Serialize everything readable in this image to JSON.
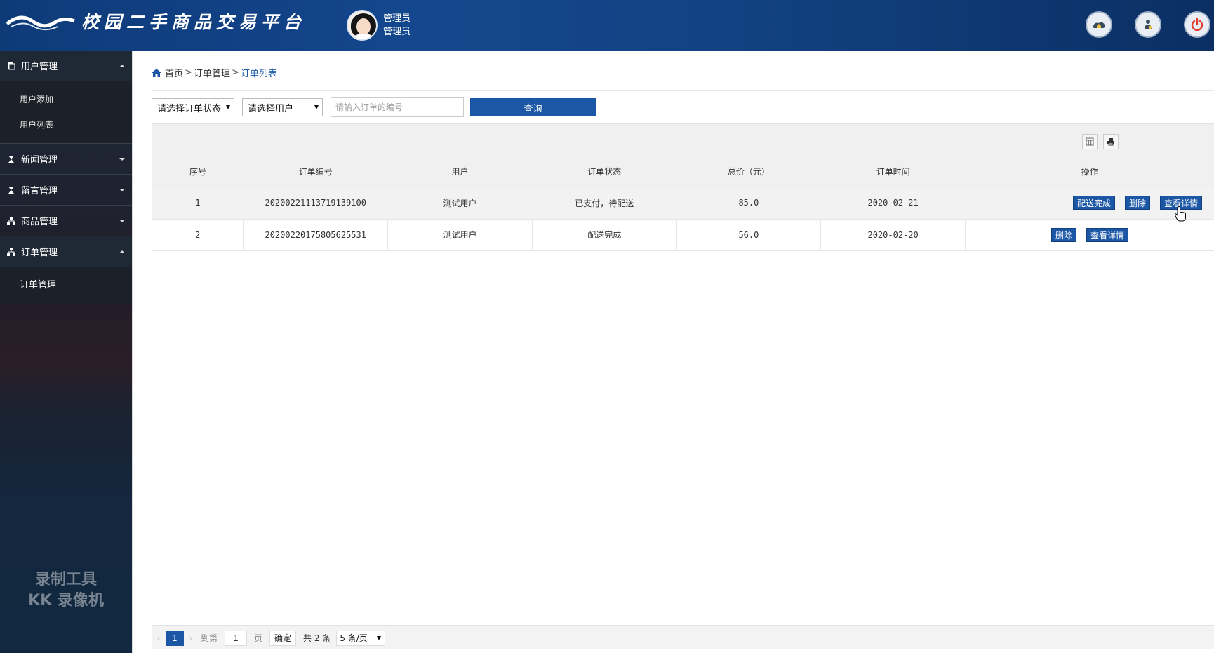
{
  "header": {
    "site_title": "校园二手商品交易平台",
    "user_role": "管理员",
    "user_name": "管理员",
    "buttons": [
      "home-icon",
      "user-icon",
      "power-icon"
    ]
  },
  "sidebar": {
    "sections": [
      {
        "label": "用户管理",
        "expanded": true,
        "items": [
          "用户添加",
          "用户列表"
        ]
      },
      {
        "label": "新闻管理",
        "expanded": false
      },
      {
        "label": "留言管理",
        "expanded": false
      },
      {
        "label": "商品管理",
        "expanded": false
      },
      {
        "label": "订单管理",
        "expanded": true,
        "items": [
          "订单管理"
        ]
      }
    ],
    "watermark_line1": "录制工具",
    "watermark_line2": "KK 录像机"
  },
  "breadcrumb": {
    "home": "首页",
    "level2": "订单管理",
    "current": "订单列表",
    "sep": ">"
  },
  "filters": {
    "status_select": "请选择订单状态",
    "user_select": "请选择用户",
    "order_no_placeholder": "请输入订单的编号",
    "query_label": "查询"
  },
  "table": {
    "columns": [
      "序号",
      "订单编号",
      "用户",
      "订单状态",
      "总价（元）",
      "订单时间",
      "操作"
    ],
    "rows": [
      {
        "index": "1",
        "order_no": "20200221113719139100",
        "user": "测试用户",
        "status": "已支付，待配送",
        "total": "85.0",
        "time": "2020-02-21",
        "actions": [
          "配送完成",
          "删除",
          "查看详情"
        ]
      },
      {
        "index": "2",
        "order_no": "20200220175805625531",
        "user": "测试用户",
        "status": "配送完成",
        "total": "56.0",
        "time": "2020-02-20",
        "actions": [
          "删除",
          "查看详情"
        ]
      }
    ]
  },
  "pagination": {
    "current_page": "1",
    "goto_label": "到第",
    "goto_value": "1",
    "page_label": "页",
    "confirm_label": "确定",
    "total_text": "共 2 条",
    "page_size": "5 条/页"
  },
  "colors": {
    "header": "#14478e",
    "primary": "#1c57a6",
    "sidebar": "#1f2935"
  }
}
